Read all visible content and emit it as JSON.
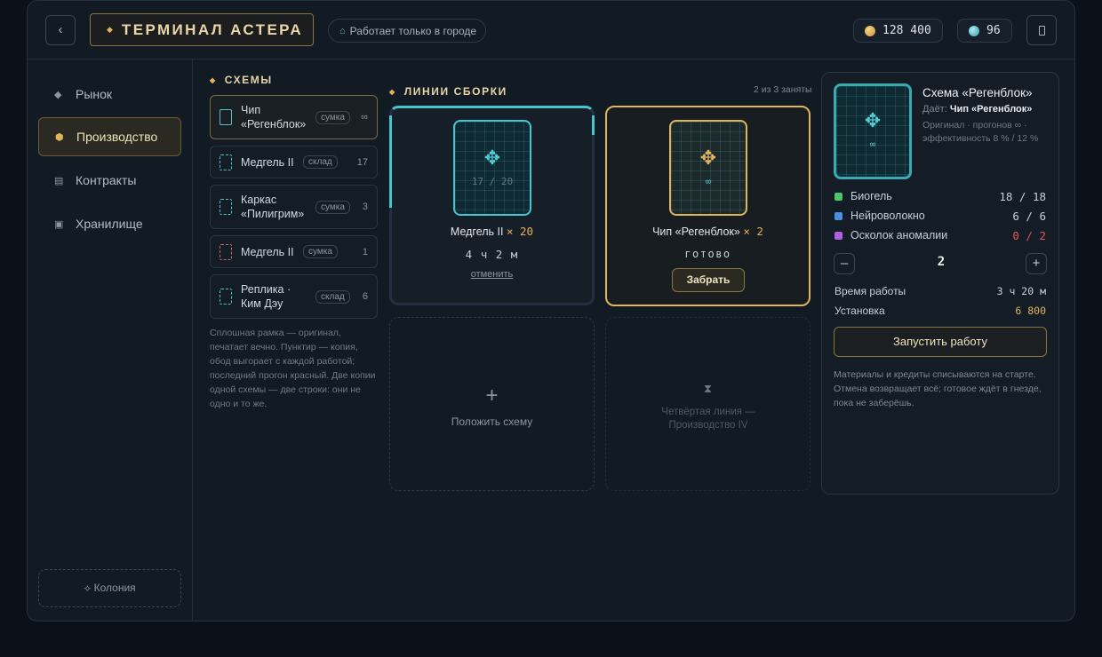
{
  "header": {
    "back": "‹",
    "title_diamond": "◆",
    "title": "ТЕРМИНАЛ АСТЕРА",
    "city_icon": "home-icon",
    "city_note": "Работает только в городе",
    "coins": "128 400",
    "gems": "96"
  },
  "sidebar": {
    "items": [
      {
        "icon": "◆",
        "label": "Рынок"
      },
      {
        "icon": "⬢",
        "label": "Производство"
      },
      {
        "icon": "▤",
        "label": "Контракты"
      },
      {
        "icon": "▣",
        "label": "Хранилище"
      }
    ],
    "colony": "⟡ Колония"
  },
  "schemes": {
    "heading": "СХЕМЫ",
    "items": [
      {
        "name": "Чип «Регенблок»",
        "tag": "сумка",
        "count": "∞"
      },
      {
        "name": "Медгель II",
        "tag": "склад",
        "count": "17"
      },
      {
        "name": "Каркас «Пилигрим»",
        "tag": "сумка",
        "count": "3"
      },
      {
        "name": "Медгель II",
        "tag": "сумка",
        "count": "1"
      },
      {
        "name": "Реплика · Ким Дэу",
        "tag": "склад",
        "count": "6"
      }
    ],
    "note": "Сплошная рамка — оригинал, печатает вечно. Пунктир — копия, обод выгорает с каждой работой; последний прогон красный. Две копии одной схемы — две строки: они не одно и то же."
  },
  "lines": {
    "heading": "ЛИНИИ СБОРКИ",
    "occupancy": "2 из 3 заняты",
    "active": {
      "runs": "17 / 20",
      "progress": 0.15,
      "name": "Медгель II",
      "qty": "× 20",
      "time_left": "4 ч 2 м",
      "cancel": "отменить"
    },
    "ready": {
      "runs": "∞",
      "name": "Чип «Регенблок»",
      "qty": "× 2",
      "status": "готово",
      "collect": "Забрать"
    },
    "empty_slot": {
      "plus": "+",
      "label": "Положить схему"
    },
    "locked_slot": {
      "icon": "⧗",
      "label": "Четвёртая линия — Производство IV"
    }
  },
  "detail": {
    "title": "Схема «Регенблок»",
    "gives_label": "Даёт:",
    "gives_value": "Чип «Регенблок»",
    "meta": "Оригинал · прогонов ∞ · эффективность 8 % / 12 %",
    "runs": "∞",
    "materials": [
      {
        "name": "Биогель",
        "have": "18 / 18",
        "color": "#4cc46a",
        "value_color": "#c8ced6"
      },
      {
        "name": "Нейроволокно",
        "have": "6 / 6",
        "color": "#4a8fe0",
        "value_color": "#c8ced6"
      },
      {
        "name": "Осколок аномалии",
        "have": "0 / 2",
        "color": "#b05ee0",
        "value_color": "#e0555e"
      }
    ],
    "minus": "–",
    "quantity": "2",
    "plus": "+",
    "work_time_label": "Время работы",
    "work_time": "3 ч 20 м",
    "install_label": "Установка",
    "install_cost": "6 800",
    "launch": "Запустить работу",
    "note": "Материалы и кредиты списываются на старте. Отмена возвращает всё; готовое ждёт в гнезде, пока не заберёшь."
  }
}
